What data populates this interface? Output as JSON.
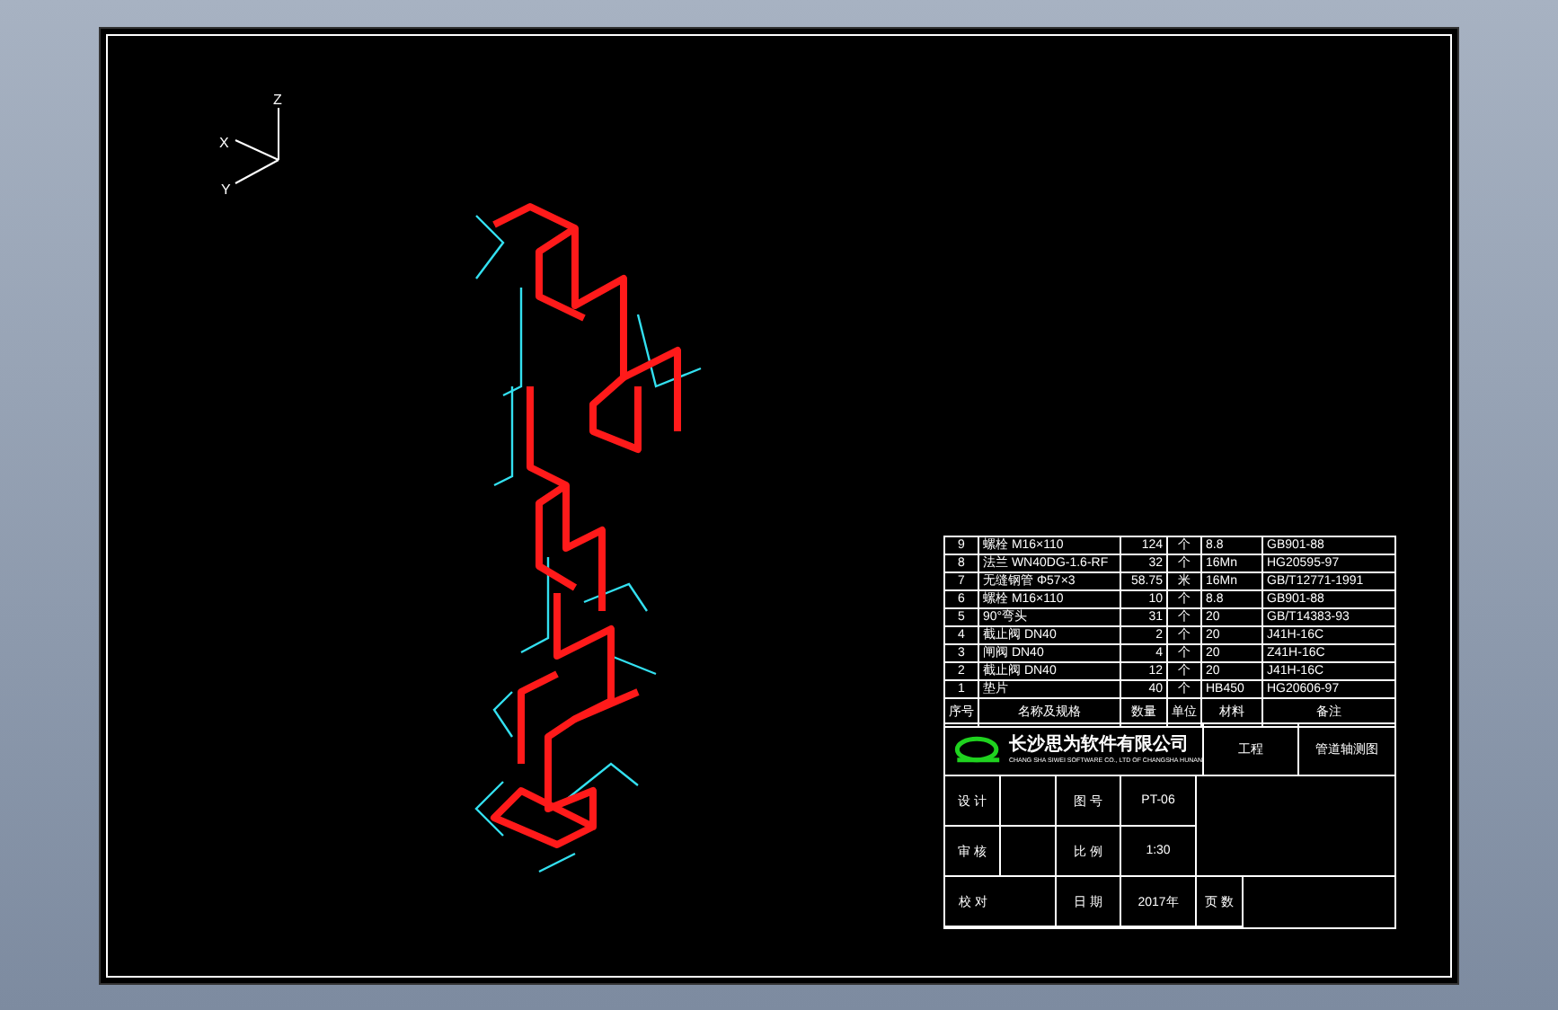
{
  "axes": {
    "z": "Z",
    "x": "X",
    "y": "Y"
  },
  "parts_list": {
    "columns": [
      "序号",
      "名称及规格",
      "数量",
      "单位",
      "材料",
      "备注"
    ],
    "rows": [
      {
        "no": "9",
        "name": "螺栓 M16×110",
        "qty": "124",
        "unit": "个",
        "material": "8.8",
        "standard": "GB901-88"
      },
      {
        "no": "8",
        "name": "法兰 WN40DG-1.6-RF",
        "qty": "32",
        "unit": "个",
        "material": "16Mn",
        "standard": "HG20595-97"
      },
      {
        "no": "7",
        "name": "无缝钢管 Φ57×3",
        "qty": "58.75",
        "unit": "米",
        "material": "16Mn",
        "standard": "GB/T12771-1991"
      },
      {
        "no": "6",
        "name": "螺栓 M16×110",
        "qty": "10",
        "unit": "个",
        "material": "8.8",
        "standard": "GB901-88"
      },
      {
        "no": "5",
        "name": "90°弯头",
        "qty": "31",
        "unit": "个",
        "material": "20",
        "standard": "GB/T14383-93"
      },
      {
        "no": "4",
        "name": "截止阀 DN40",
        "qty": "2",
        "unit": "个",
        "material": "20",
        "standard": "J41H-16C"
      },
      {
        "no": "3",
        "name": "闸阀 DN40",
        "qty": "4",
        "unit": "个",
        "material": "20",
        "standard": "Z41H-16C"
      },
      {
        "no": "2",
        "name": "截止阀 DN40",
        "qty": "12",
        "unit": "个",
        "material": "20",
        "standard": "J41H-16C"
      },
      {
        "no": "1",
        "name": "垫片",
        "qty": "40",
        "unit": "个",
        "material": "HB450",
        "standard": "HG20606-97"
      }
    ]
  },
  "title_block": {
    "company": "长沙思为软件有限公司",
    "company_en": "CHANG SHA SIWEI SOFTWARE CO., LTD OF CHANGSHA HUNAN",
    "project_label": "工程",
    "drawing_title": "管道轴测图",
    "rows": [
      {
        "role": "设 计",
        "field": "图 号",
        "value": "PT-06"
      },
      {
        "role": "审 核",
        "field": "比 例",
        "value": "1:30"
      },
      {
        "role": "校 对",
        "field": "日 期",
        "value": "2017年",
        "extra": "页 数"
      }
    ]
  }
}
